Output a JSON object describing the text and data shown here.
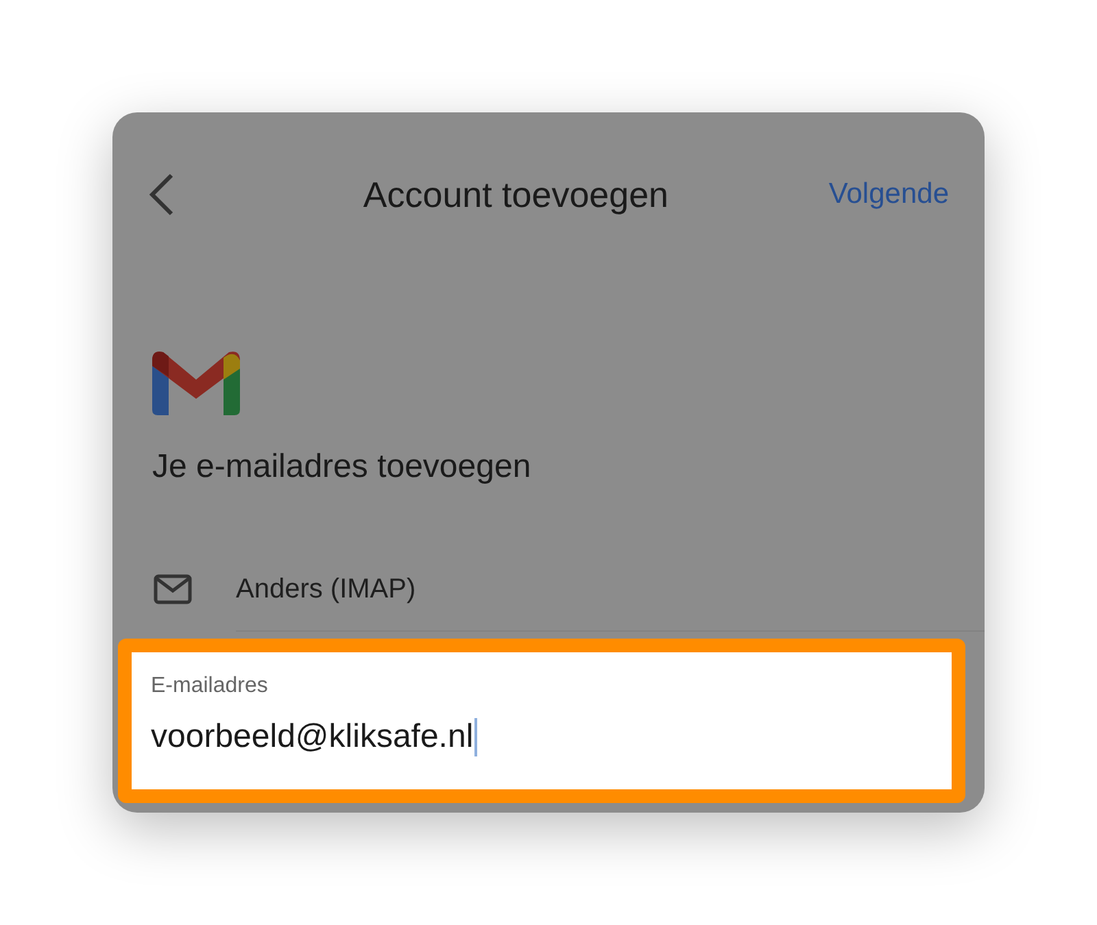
{
  "header": {
    "title": "Account toevoegen",
    "next_button": "Volgende"
  },
  "heading": "Je e-mailadres toevoegen",
  "options": [
    {
      "label": "Anders (IMAP)"
    }
  ],
  "email_field": {
    "label": "E-mailadres",
    "value": "voorbeeld@kliksafe.nl",
    "focused": true,
    "highlighted": true
  }
}
